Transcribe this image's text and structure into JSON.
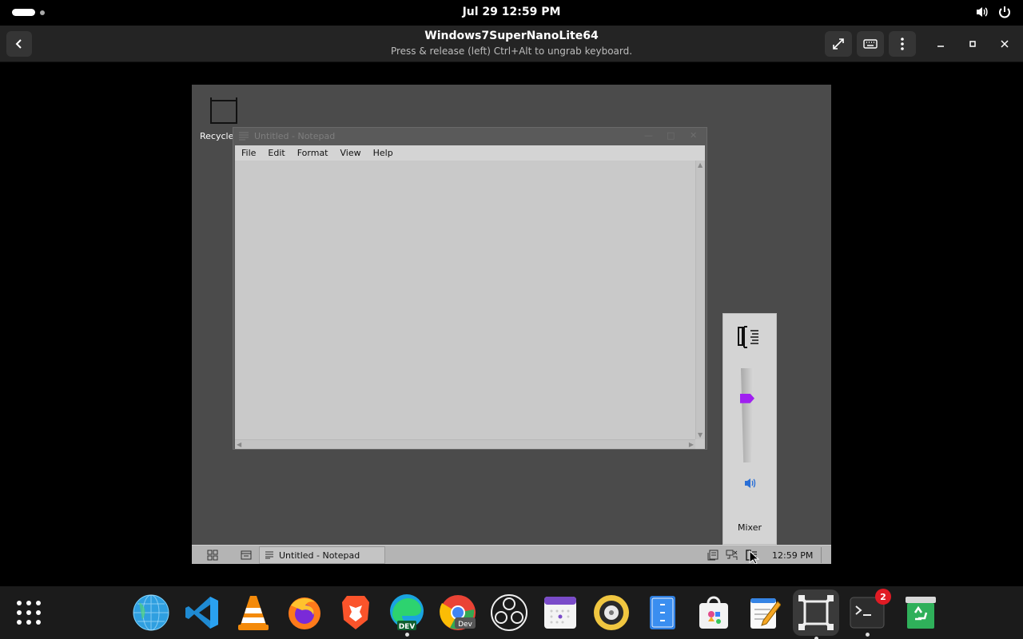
{
  "top_bar": {
    "clock": "Jul 29  12:59 PM",
    "icons": [
      "volume-icon",
      "power-icon"
    ]
  },
  "boxes_header": {
    "title": "Windows7SuperNanoLite64",
    "subtitle": "Press & release (left) Ctrl+Alt to ungrab keyboard.",
    "buttons": [
      "back-button",
      "fullscreen-button",
      "keyboard-button",
      "menu-button",
      "minimize-button",
      "maximize-button",
      "close-button"
    ]
  },
  "vm": {
    "desktop": {
      "recycle_label": "Recycle"
    },
    "notepad": {
      "title": "Untitled - Notepad",
      "menu": [
        "File",
        "Edit",
        "Format",
        "View",
        "Help"
      ],
      "content": ""
    },
    "mixer": {
      "label": "Mixer",
      "volume_level": 0.7
    },
    "taskbar": {
      "task_label": "Untitled - Notepad",
      "clock": "12:59 PM"
    }
  },
  "dock": {
    "apps": [
      {
        "name": "show-apps",
        "icon": "app-grid-icon"
      },
      {
        "name": "globe",
        "icon": "globe-icon"
      },
      {
        "name": "vscode",
        "icon": "vscode-icon"
      },
      {
        "name": "vlc",
        "icon": "vlc-icon"
      },
      {
        "name": "firefox",
        "icon": "firefox-icon"
      },
      {
        "name": "brave",
        "icon": "brave-icon"
      },
      {
        "name": "edge-dev",
        "icon": "edge-dev-icon",
        "label": "DEV"
      },
      {
        "name": "chrome-dev",
        "icon": "chrome-dev-icon",
        "label": "Dev"
      },
      {
        "name": "obs",
        "icon": "obs-icon"
      },
      {
        "name": "calendar",
        "icon": "calendar-icon"
      },
      {
        "name": "rhythmbox",
        "icon": "speaker-icon"
      },
      {
        "name": "files",
        "icon": "file-cabinet-icon"
      },
      {
        "name": "software",
        "icon": "software-bag-icon"
      },
      {
        "name": "text-editor",
        "icon": "text-editor-icon"
      },
      {
        "name": "boxes",
        "icon": "boxes-icon"
      },
      {
        "name": "terminal",
        "icon": "terminal-icon",
        "badge": "2"
      },
      {
        "name": "trash",
        "icon": "recycle-bin-icon"
      }
    ]
  }
}
